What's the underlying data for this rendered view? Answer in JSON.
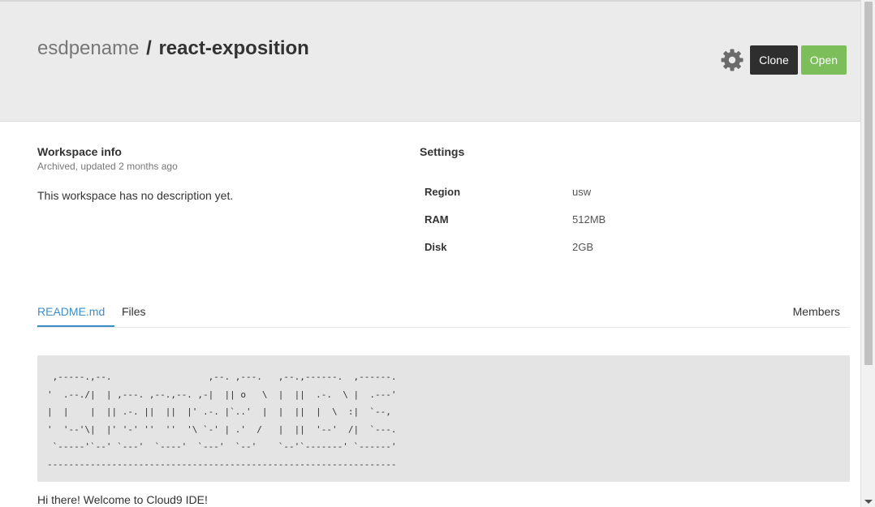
{
  "header": {
    "owner": "esdpename",
    "separator": "/",
    "workspace_name": "react-exposition",
    "clone_label": "Clone",
    "open_label": "Open"
  },
  "info": {
    "title": "Workspace info",
    "meta": "Archived, updated 2 months ago",
    "description": "This workspace has no description yet."
  },
  "settings": {
    "title": "Settings",
    "rows": [
      {
        "key": "Region",
        "value": "usw"
      },
      {
        "key": "RAM",
        "value": "512MB"
      },
      {
        "key": "Disk",
        "value": "2GB"
      }
    ]
  },
  "tabs": {
    "readme": "README.md",
    "files": "Files",
    "members": "Members"
  },
  "readme": {
    "ascii_art": " ,-----.,--.                  ,--. ,---.   ,--.,------.  ,------.\n'  .--./|  | ,---. ,--.,--. ,-|  || o   \\  |  ||  .-.  \\ |  .---'\n|  |    |  || .-. ||  ||  |' .-. |`..'  |  |  ||  |  \\  :|  `--,\n'  '--'\\|  |' '-' ''  ''  '\\ `-' | .'  /   |  ||  '--'  /|  `---.\n `-----'`--' `---'  `----'  `---'  `--'    `--'`-------' `------'\n-----------------------------------------------------------------",
    "welcome": "Hi there! Welcome to Cloud9 IDE!"
  },
  "colors": {
    "accent": "#3b8ec6",
    "open_button": "#7cbf5a",
    "clone_button": "#2e2e2e",
    "header_bg": "#ebebeb"
  },
  "icons": {
    "settings": "gear-icon"
  }
}
